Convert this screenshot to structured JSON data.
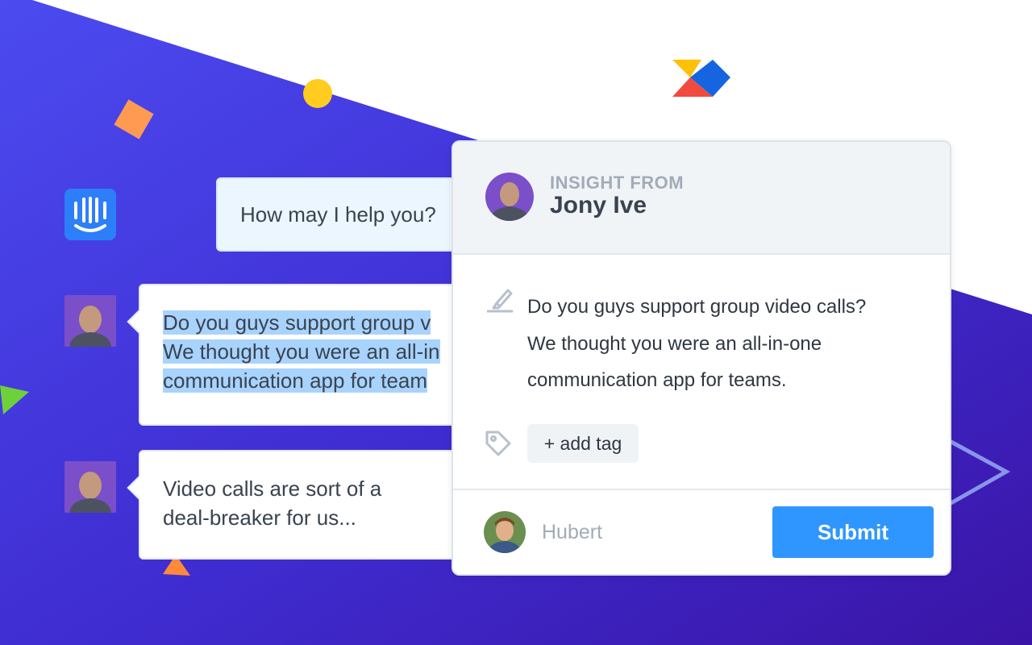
{
  "colors": {
    "gradient_start": "#4a3fe6",
    "gradient_end": "#3d18b0",
    "accent_blue": "#2f96ff",
    "intercom_blue": "#2d7ff9"
  },
  "icons": {
    "intercom_logo": "intercom-logo-icon",
    "highlighter": "highlighter-icon",
    "tag": "tag-icon",
    "brand_logo": "brand-logo-icon"
  },
  "chat": {
    "operator_message": "How may I help you?",
    "user_message_1": [
      "Do you guys support group v",
      "We thought you were an all-in",
      "communication app for team"
    ],
    "user_message_2": [
      "Video calls are sort of a",
      "deal-breaker for us..."
    ]
  },
  "card": {
    "header_label": "INSIGHT FROM",
    "header_name": "Jony Ive",
    "quote_lines": [
      "Do you guys support group video calls?",
      "We thought you were an all-in-one",
      "communication app for teams."
    ],
    "add_tag_label": "+ add tag",
    "assignee_name": "Hubert",
    "submit_label": "Submit"
  }
}
